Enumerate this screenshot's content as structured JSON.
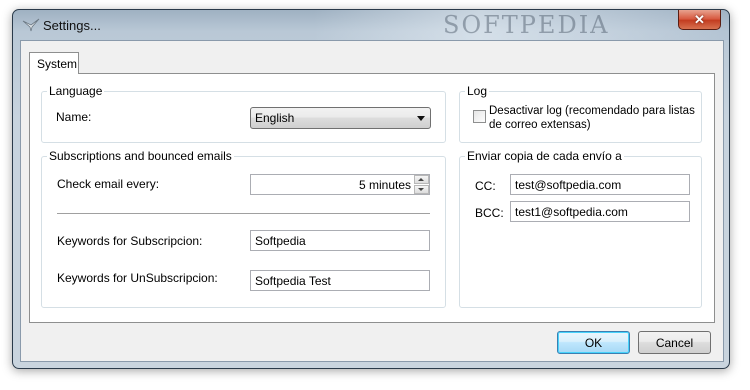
{
  "window": {
    "title": "Settings...",
    "watermark": "SOFTPEDIA"
  },
  "tabs": [
    {
      "label": "System"
    }
  ],
  "language": {
    "group_label": "Language",
    "name_label": "Name:",
    "name_value": "English"
  },
  "log": {
    "group_label": "Log",
    "checkbox_label_line1": "Desactivar log (recomendado para listas",
    "checkbox_label_line2": "de correo extensas)",
    "checked": false
  },
  "subscriptions": {
    "group_label": "Subscriptions and bounced emails",
    "check_label": "Check email every:",
    "check_value": "5 minutes",
    "subscribe_label": "Keywords for Subscripcion:",
    "subscribe_value": "Softpedia",
    "unsubscribe_label": "Keywords for UnSubscripcion:",
    "unsubscribe_value": "Softpedia Test"
  },
  "copy": {
    "group_label": "Enviar copia de cada envío a",
    "cc_label": "CC:",
    "cc_value": "test@softpedia.com",
    "bcc_label": "BCC:",
    "bcc_value": "test1@softpedia.com"
  },
  "buttons": {
    "ok": "OK",
    "cancel": "Cancel"
  }
}
